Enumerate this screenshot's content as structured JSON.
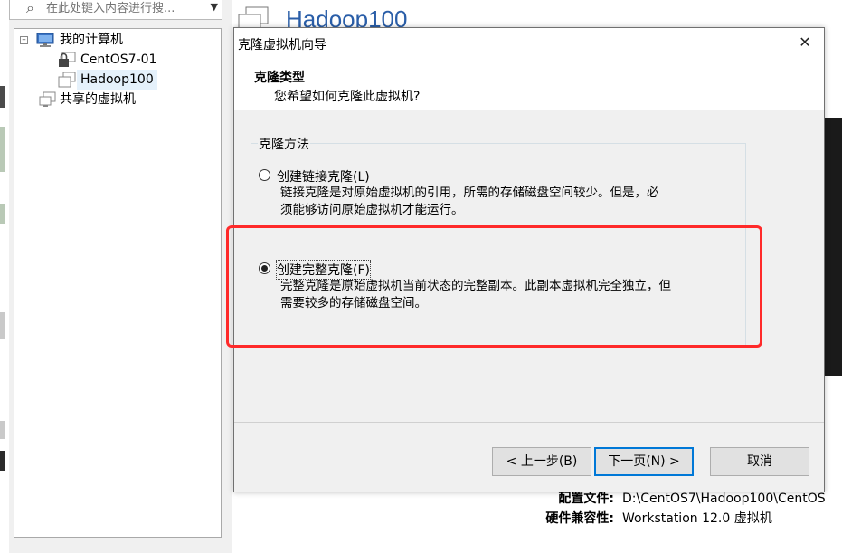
{
  "search": {
    "placeholder": "在此处键入内容进行搜..."
  },
  "tree": {
    "root_label": "我的计算机",
    "items": [
      {
        "label": "CentOS7-01",
        "icon": "locked-vm-icon"
      },
      {
        "label": "Hadoop100",
        "icon": "vm-icon"
      }
    ],
    "shared_label": "共享的虚拟机"
  },
  "main": {
    "vm_title": "Hadoop100",
    "details": [
      {
        "key": "配置文件:",
        "value": "D:\\CentOS7\\Hadoop100\\CentOS"
      },
      {
        "key": "硬件兼容性:",
        "value": "Workstation 12.0 虚拟机"
      }
    ]
  },
  "dialog": {
    "title": "克隆虚拟机向导",
    "close_icon": "close-icon",
    "header_title": "克隆类型",
    "header_subtitle": "您希望如何克隆此虚拟机?",
    "group_label": "克隆方法",
    "options": [
      {
        "label": "创建链接克隆(L)",
        "checked": false,
        "desc_line1": "链接克隆是对原始虚拟机的引用，所需的存储磁盘空间较少。但是，必",
        "desc_line2": "须能够访问原始虚拟机才能运行。"
      },
      {
        "label": "创建完整克隆(F)",
        "checked": true,
        "desc_line1": "完整克隆是原始虚拟机当前状态的完整副本。此副本虚拟机完全独立，但",
        "desc_line2": "需要较多的存储磁盘空间。"
      }
    ],
    "buttons": {
      "back": "< 上一步(B)",
      "next": "下一页(N) >",
      "cancel": "取消"
    }
  },
  "annotation_color": "#ff2a2a",
  "accent_color": "#0078d7"
}
